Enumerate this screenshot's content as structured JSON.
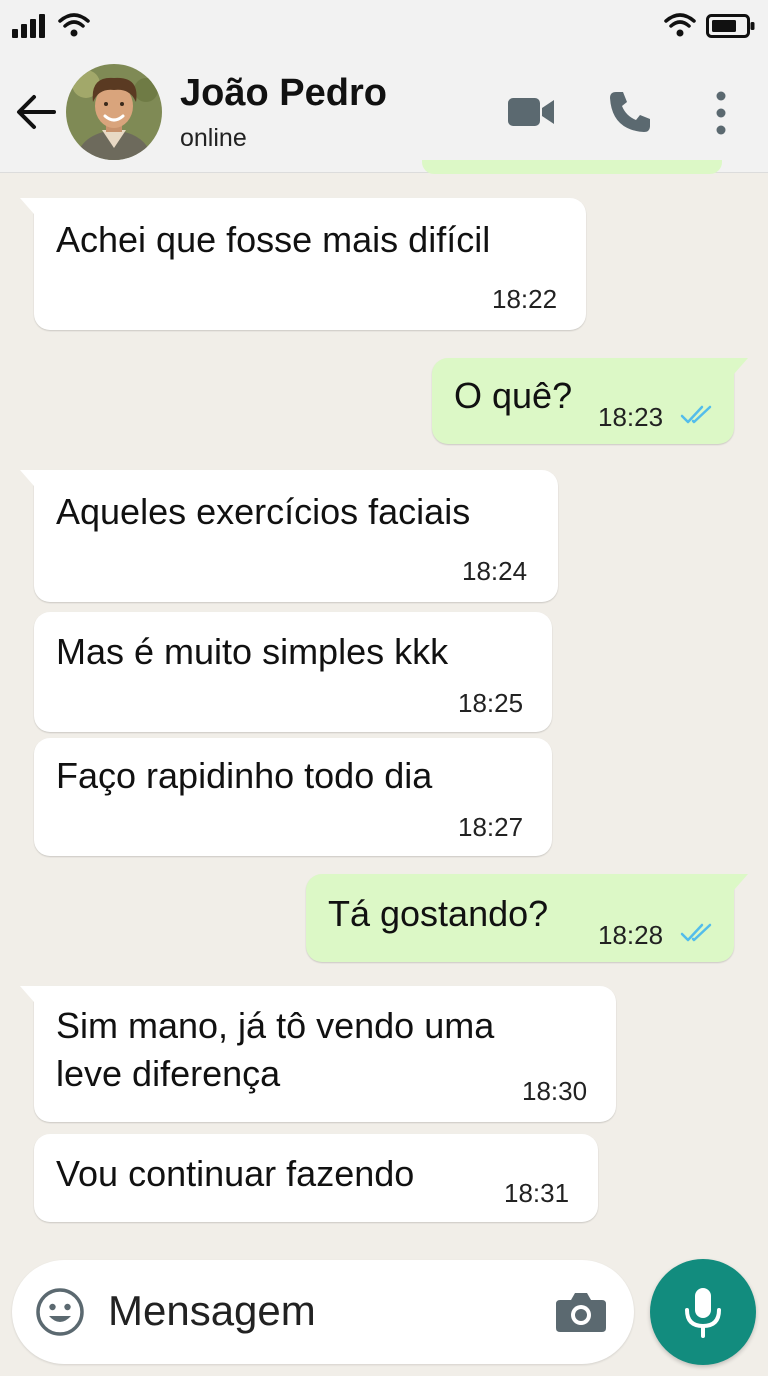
{
  "header": {
    "contact_name": "João Pedro",
    "contact_status": "online",
    "icons": {
      "back": "arrow-left-icon",
      "video": "video-camera-icon",
      "call": "phone-icon",
      "more": "more-vertical-icon"
    }
  },
  "messages": [
    {
      "direction": "incoming",
      "text": "Achei que fosse mais difícil",
      "time": "18:22"
    },
    {
      "direction": "outgoing",
      "text": "O quê?",
      "time": "18:23",
      "status": "read"
    },
    {
      "direction": "incoming",
      "text": "Aqueles exercícios faciais",
      "time": "18:24"
    },
    {
      "direction": "incoming",
      "text": "Mas é muito simples kkk",
      "time": "18:25"
    },
    {
      "direction": "incoming",
      "text": "Faço rapidinho todo dia",
      "time": "18:27"
    },
    {
      "direction": "outgoing",
      "text": "Tá gostando?",
      "time": "18:28",
      "status": "read"
    },
    {
      "direction": "incoming",
      "lines": [
        "Sim mano, já tô vendo uma",
        "leve diferença"
      ],
      "time": "18:30"
    },
    {
      "direction": "incoming",
      "text": "Vou continuar fazendo",
      "time": "18:31"
    }
  ],
  "composer": {
    "placeholder": "Mensagem",
    "icons": {
      "emoji": "emoji-icon",
      "camera": "camera-icon",
      "mic": "microphone-icon"
    }
  },
  "colors": {
    "chat_background": "#f1eee8",
    "incoming_bubble": "#ffffff",
    "outgoing_bubble": "#dcf8c6",
    "accent": "#128c7e",
    "read_ticks": "#53bdeb",
    "icons": "#5b6970"
  }
}
